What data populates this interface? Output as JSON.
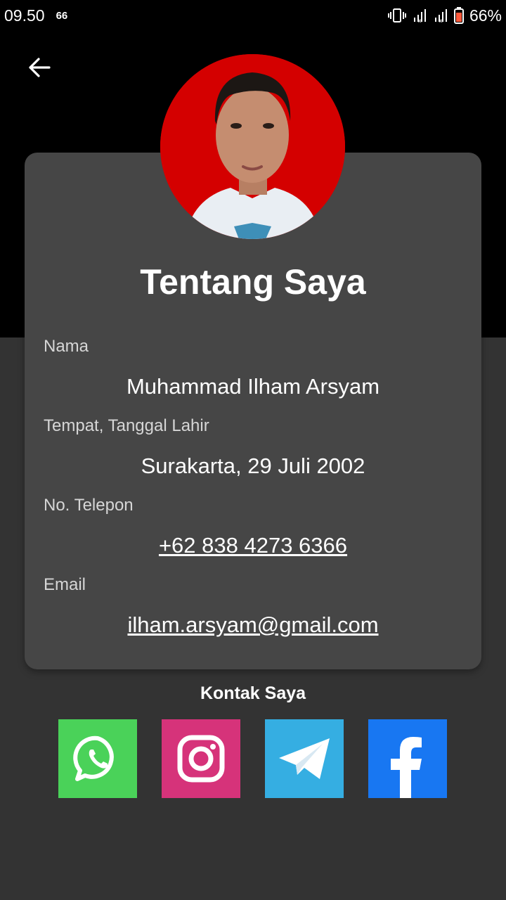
{
  "status_bar": {
    "time": "09.50",
    "notification": "66",
    "battery": "66%",
    "icons": [
      "vibrate-icon",
      "signal-icon",
      "signal-icon",
      "battery-icon"
    ]
  },
  "header": {
    "back_icon": "arrow-left-icon"
  },
  "profile": {
    "title": "Tentang Saya",
    "fields": [
      {
        "label": "Nama",
        "value": "Muhammad Ilham Arsyam"
      },
      {
        "label": "Tempat, Tanggal Lahir",
        "value": "Surakarta, 29 Juli 2002"
      },
      {
        "label": "No. Telepon",
        "value": "+62 838 4273 6366"
      },
      {
        "label": "Email",
        "value": "ilham.arsyam@gmail.com"
      }
    ]
  },
  "contacts": {
    "title": "Kontak Saya",
    "items": [
      {
        "icon": "whatsapp-icon",
        "color": "#4AD259"
      },
      {
        "icon": "instagram-icon",
        "color": "#D6337A"
      },
      {
        "icon": "telegram-icon",
        "color": "#35AEE2"
      },
      {
        "icon": "facebook-icon",
        "color": "#1877F2"
      }
    ]
  },
  "colors": {
    "background": "#333333",
    "header": "#000000",
    "card": "#464646",
    "avatar_background": "#D40000"
  }
}
